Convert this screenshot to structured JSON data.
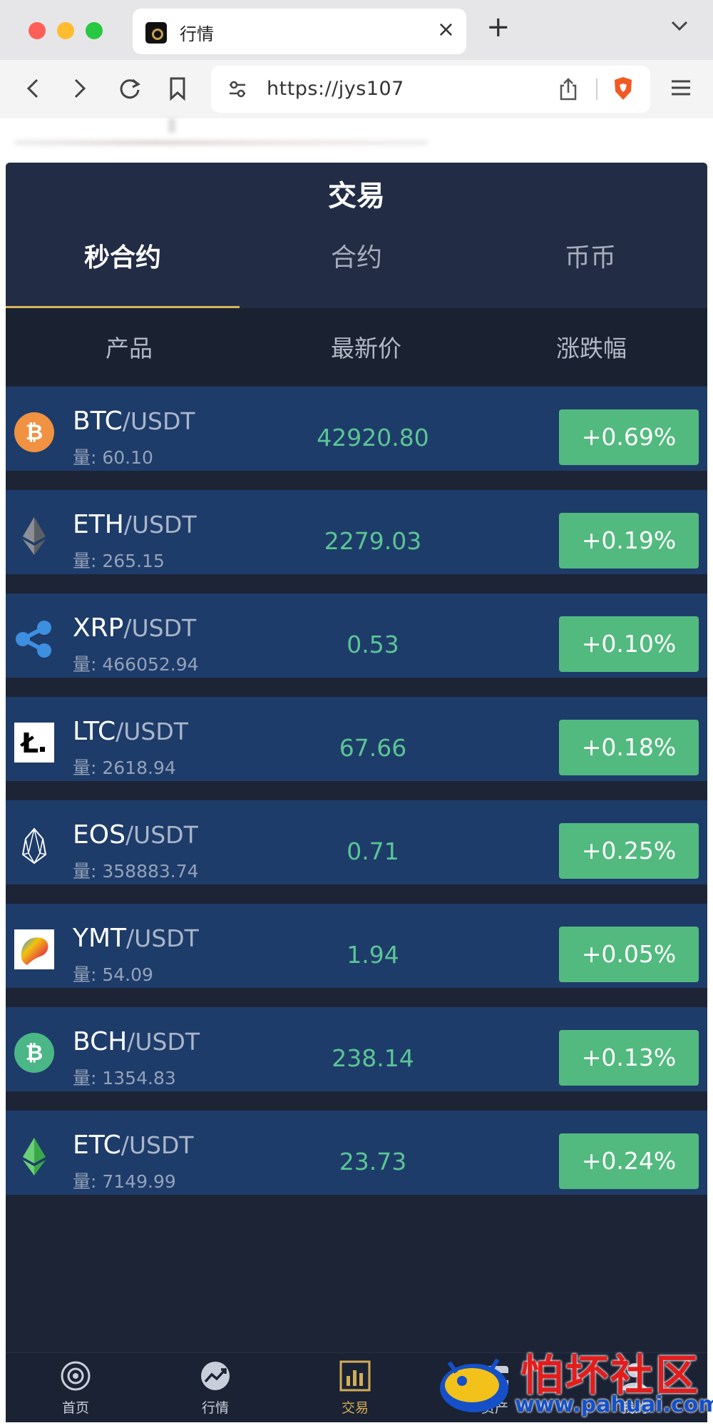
{
  "browser": {
    "tab_title": "行情",
    "url": "https://jys107"
  },
  "app": {
    "title": "交易",
    "tabs": [
      {
        "label": "秒合约",
        "active": true
      },
      {
        "label": "合约",
        "active": false
      },
      {
        "label": "币币",
        "active": false
      }
    ],
    "columns": {
      "product": "产品",
      "price": "最新价",
      "change": "涨跌幅"
    },
    "rows": [
      {
        "symbol": "BTC",
        "pair": "/USDT",
        "volume": "量: 60.10",
        "price": "42920.80",
        "change": "+0.69%",
        "icon": "btc-icon"
      },
      {
        "symbol": "ETH",
        "pair": "/USDT",
        "volume": "量: 265.15",
        "price": "2279.03",
        "change": "+0.19%",
        "icon": "eth-icon"
      },
      {
        "symbol": "XRP",
        "pair": "/USDT",
        "volume": "量: 466052.94",
        "price": "0.53",
        "change": "+0.10%",
        "icon": "xrp-icon"
      },
      {
        "symbol": "LTC",
        "pair": "/USDT",
        "volume": "量: 2618.94",
        "price": "67.66",
        "change": "+0.18%",
        "icon": "ltc-icon"
      },
      {
        "symbol": "EOS",
        "pair": "/USDT",
        "volume": "量: 358883.74",
        "price": "0.71",
        "change": "+0.25%",
        "icon": "eos-icon"
      },
      {
        "symbol": "YMT",
        "pair": "/USDT",
        "volume": "量: 54.09",
        "price": "1.94",
        "change": "+0.05%",
        "icon": "ymt-icon"
      },
      {
        "symbol": "BCH",
        "pair": "/USDT",
        "volume": "量: 1354.83",
        "price": "238.14",
        "change": "+0.13%",
        "icon": "bch-icon"
      },
      {
        "symbol": "ETC",
        "pair": "/USDT",
        "volume": "量: 7149.99",
        "price": "23.73",
        "change": "+0.24%",
        "icon": "etc-icon"
      }
    ],
    "bottom_nav": [
      {
        "label": "首页",
        "icon": "home-icon",
        "active": false
      },
      {
        "label": "行情",
        "icon": "chart-icon",
        "active": false
      },
      {
        "label": "交易",
        "icon": "trade-icon",
        "active": true
      },
      {
        "label": "资产",
        "icon": "wallet-icon",
        "active": false
      },
      {
        "label": "我的",
        "icon": "user-icon",
        "active": false
      }
    ]
  },
  "watermark": {
    "text": "怕坏社区",
    "url": "www.pahuai.com"
  },
  "colors": {
    "app_bg": "#1d2436",
    "header_bg": "#222c45",
    "row_bg": "#1e3c6a",
    "price_green": "#5bc595",
    "badge_green": "#52ba7f",
    "accent_gold": "#d6b35e"
  }
}
